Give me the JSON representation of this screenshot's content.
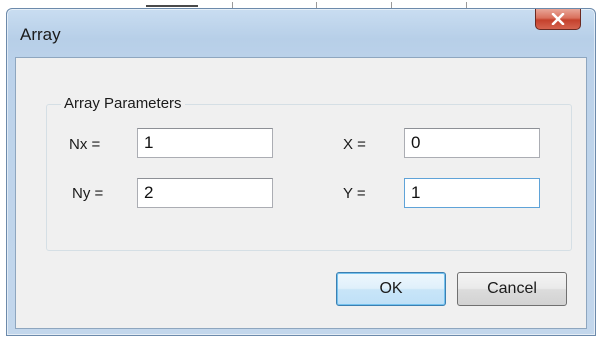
{
  "window": {
    "title": "Array"
  },
  "group": {
    "label": "Array Parameters"
  },
  "fields": {
    "nx": {
      "label": "Nx =",
      "value": "1"
    },
    "ny": {
      "label": "Ny =",
      "value": "2"
    },
    "x": {
      "label": "X =",
      "value": "0"
    },
    "y": {
      "label": "Y =",
      "value": "1"
    }
  },
  "buttons": {
    "ok": "OK",
    "cancel": "Cancel"
  },
  "icons": {
    "close": "close-icon"
  },
  "colors": {
    "close_button": "#c4412c",
    "focus_border": "#5fa3d8",
    "title_bar": "#b7cfe8"
  }
}
